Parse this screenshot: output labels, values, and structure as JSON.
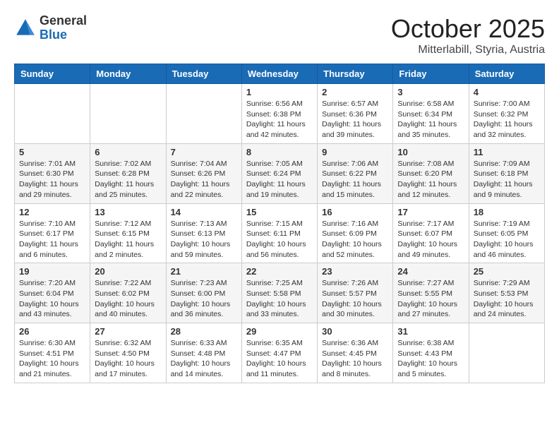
{
  "header": {
    "logo_general": "General",
    "logo_blue": "Blue",
    "month": "October 2025",
    "location": "Mitterlabill, Styria, Austria"
  },
  "weekdays": [
    "Sunday",
    "Monday",
    "Tuesday",
    "Wednesday",
    "Thursday",
    "Friday",
    "Saturday"
  ],
  "weeks": [
    [
      {
        "day": "",
        "info": ""
      },
      {
        "day": "",
        "info": ""
      },
      {
        "day": "",
        "info": ""
      },
      {
        "day": "1",
        "info": "Sunrise: 6:56 AM\nSunset: 6:38 PM\nDaylight: 11 hours\nand 42 minutes."
      },
      {
        "day": "2",
        "info": "Sunrise: 6:57 AM\nSunset: 6:36 PM\nDaylight: 11 hours\nand 39 minutes."
      },
      {
        "day": "3",
        "info": "Sunrise: 6:58 AM\nSunset: 6:34 PM\nDaylight: 11 hours\nand 35 minutes."
      },
      {
        "day": "4",
        "info": "Sunrise: 7:00 AM\nSunset: 6:32 PM\nDaylight: 11 hours\nand 32 minutes."
      }
    ],
    [
      {
        "day": "5",
        "info": "Sunrise: 7:01 AM\nSunset: 6:30 PM\nDaylight: 11 hours\nand 29 minutes."
      },
      {
        "day": "6",
        "info": "Sunrise: 7:02 AM\nSunset: 6:28 PM\nDaylight: 11 hours\nand 25 minutes."
      },
      {
        "day": "7",
        "info": "Sunrise: 7:04 AM\nSunset: 6:26 PM\nDaylight: 11 hours\nand 22 minutes."
      },
      {
        "day": "8",
        "info": "Sunrise: 7:05 AM\nSunset: 6:24 PM\nDaylight: 11 hours\nand 19 minutes."
      },
      {
        "day": "9",
        "info": "Sunrise: 7:06 AM\nSunset: 6:22 PM\nDaylight: 11 hours\nand 15 minutes."
      },
      {
        "day": "10",
        "info": "Sunrise: 7:08 AM\nSunset: 6:20 PM\nDaylight: 11 hours\nand 12 minutes."
      },
      {
        "day": "11",
        "info": "Sunrise: 7:09 AM\nSunset: 6:18 PM\nDaylight: 11 hours\nand 9 minutes."
      }
    ],
    [
      {
        "day": "12",
        "info": "Sunrise: 7:10 AM\nSunset: 6:17 PM\nDaylight: 11 hours\nand 6 minutes."
      },
      {
        "day": "13",
        "info": "Sunrise: 7:12 AM\nSunset: 6:15 PM\nDaylight: 11 hours\nand 2 minutes."
      },
      {
        "day": "14",
        "info": "Sunrise: 7:13 AM\nSunset: 6:13 PM\nDaylight: 10 hours\nand 59 minutes."
      },
      {
        "day": "15",
        "info": "Sunrise: 7:15 AM\nSunset: 6:11 PM\nDaylight: 10 hours\nand 56 minutes."
      },
      {
        "day": "16",
        "info": "Sunrise: 7:16 AM\nSunset: 6:09 PM\nDaylight: 10 hours\nand 52 minutes."
      },
      {
        "day": "17",
        "info": "Sunrise: 7:17 AM\nSunset: 6:07 PM\nDaylight: 10 hours\nand 49 minutes."
      },
      {
        "day": "18",
        "info": "Sunrise: 7:19 AM\nSunset: 6:05 PM\nDaylight: 10 hours\nand 46 minutes."
      }
    ],
    [
      {
        "day": "19",
        "info": "Sunrise: 7:20 AM\nSunset: 6:04 PM\nDaylight: 10 hours\nand 43 minutes."
      },
      {
        "day": "20",
        "info": "Sunrise: 7:22 AM\nSunset: 6:02 PM\nDaylight: 10 hours\nand 40 minutes."
      },
      {
        "day": "21",
        "info": "Sunrise: 7:23 AM\nSunset: 6:00 PM\nDaylight: 10 hours\nand 36 minutes."
      },
      {
        "day": "22",
        "info": "Sunrise: 7:25 AM\nSunset: 5:58 PM\nDaylight: 10 hours\nand 33 minutes."
      },
      {
        "day": "23",
        "info": "Sunrise: 7:26 AM\nSunset: 5:57 PM\nDaylight: 10 hours\nand 30 minutes."
      },
      {
        "day": "24",
        "info": "Sunrise: 7:27 AM\nSunset: 5:55 PM\nDaylight: 10 hours\nand 27 minutes."
      },
      {
        "day": "25",
        "info": "Sunrise: 7:29 AM\nSunset: 5:53 PM\nDaylight: 10 hours\nand 24 minutes."
      }
    ],
    [
      {
        "day": "26",
        "info": "Sunrise: 6:30 AM\nSunset: 4:51 PM\nDaylight: 10 hours\nand 21 minutes."
      },
      {
        "day": "27",
        "info": "Sunrise: 6:32 AM\nSunset: 4:50 PM\nDaylight: 10 hours\nand 17 minutes."
      },
      {
        "day": "28",
        "info": "Sunrise: 6:33 AM\nSunset: 4:48 PM\nDaylight: 10 hours\nand 14 minutes."
      },
      {
        "day": "29",
        "info": "Sunrise: 6:35 AM\nSunset: 4:47 PM\nDaylight: 10 hours\nand 11 minutes."
      },
      {
        "day": "30",
        "info": "Sunrise: 6:36 AM\nSunset: 4:45 PM\nDaylight: 10 hours\nand 8 minutes."
      },
      {
        "day": "31",
        "info": "Sunrise: 6:38 AM\nSunset: 4:43 PM\nDaylight: 10 hours\nand 5 minutes."
      },
      {
        "day": "",
        "info": ""
      }
    ]
  ]
}
